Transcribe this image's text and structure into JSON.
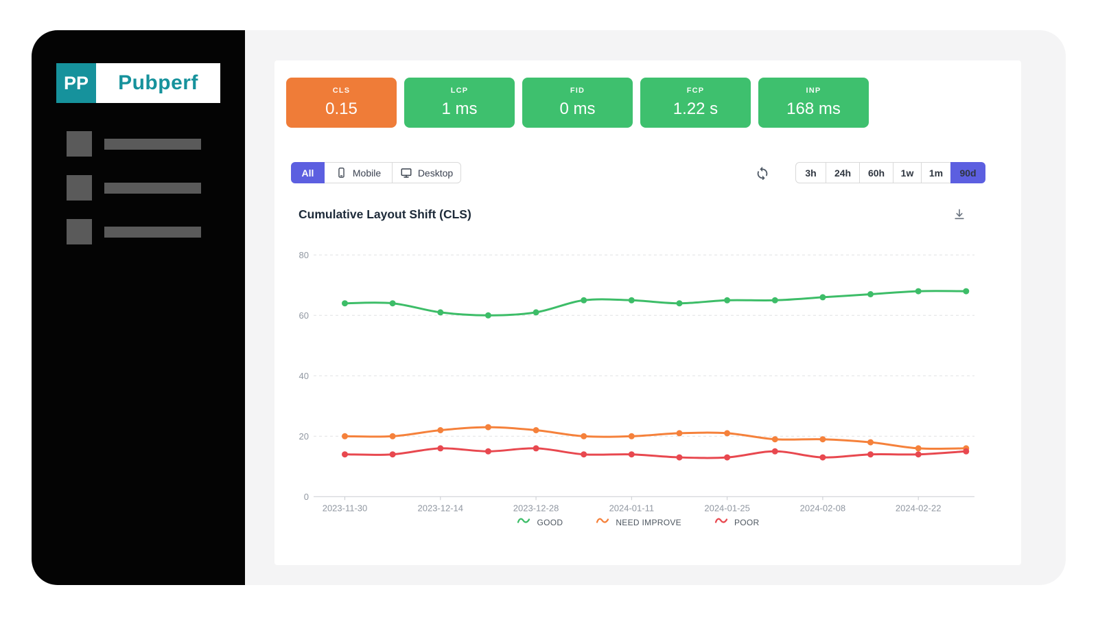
{
  "app": {
    "name": "Pubperf",
    "colors": {
      "sidebar_bg": "#040404",
      "panel_bg": "#f4f4f5",
      "accent_purple": "#5c5fe0",
      "teal": "#16929c",
      "good_green": "#3ec06e",
      "warn_orange": "#ef7c38"
    }
  },
  "sidebar": {
    "logo": {
      "abbr": "PP",
      "name": "Pubperf",
      "teal": "#16929c"
    },
    "skeleton_item_count": 3
  },
  "metrics": {
    "colors": {
      "good": "#3ec06e",
      "warn": "#ef7c38"
    },
    "cards": [
      {
        "label": "CLS",
        "value": "0.15",
        "status": "warn"
      },
      {
        "label": "LCP",
        "value": "1 ms",
        "status": "good"
      },
      {
        "label": "FID",
        "value": "0 ms",
        "status": "good"
      },
      {
        "label": "FCP",
        "value": "1.22 s",
        "status": "good"
      },
      {
        "label": "INP",
        "value": "168 ms",
        "status": "good"
      }
    ]
  },
  "filters": {
    "active_color": "#5c5fe0",
    "device": [
      {
        "label": "All",
        "active": true
      },
      {
        "label": "Mobile",
        "icon": "mobile-icon",
        "active": false
      },
      {
        "label": "Desktop",
        "icon": "desktop-icon",
        "active": false
      }
    ],
    "refresh_icon": "refresh-icon",
    "ranges": [
      {
        "label": "3h",
        "active": false
      },
      {
        "label": "24h",
        "active": false
      },
      {
        "label": "60h",
        "active": false
      },
      {
        "label": "1w",
        "active": false
      },
      {
        "label": "1m",
        "active": false
      },
      {
        "label": "90d",
        "active": true
      }
    ]
  },
  "chart": {
    "title": "Cumulative Layout Shift (CLS)",
    "download_icon": "download-icon"
  },
  "chart_data": {
    "type": "line",
    "title": "Cumulative Layout Shift (CLS)",
    "x": [
      "2023-11-30",
      "2023-12-07",
      "2023-12-14",
      "2023-12-21",
      "2023-12-28",
      "2024-01-04",
      "2024-01-11",
      "2024-01-18",
      "2024-01-25",
      "2024-02-01",
      "2024-02-08",
      "2024-02-15",
      "2024-02-22",
      "2024-02-29"
    ],
    "x_tick_labels": [
      "2023-11-30",
      "2023-12-14",
      "2023-12-28",
      "2024-01-11",
      "2024-01-25",
      "2024-02-08",
      "2024-02-22"
    ],
    "yticks": [
      0,
      20,
      40,
      60,
      80
    ],
    "ylim": [
      0,
      87
    ],
    "grid": "horizontal-dashed",
    "legend_position": "bottom",
    "series": [
      {
        "name": "GOOD",
        "color": "#3dbd68",
        "values": [
          64,
          64,
          61,
          60,
          61,
          65,
          65,
          64,
          65,
          65,
          66,
          67,
          68,
          68
        ]
      },
      {
        "name": "NEED IMPROVE",
        "color": "#f5813b",
        "values": [
          20,
          20,
          22,
          23,
          22,
          20,
          20,
          21,
          21,
          19,
          19,
          18,
          16,
          16
        ]
      },
      {
        "name": "POOR",
        "color": "#e8484f",
        "values": [
          14,
          14,
          16,
          15,
          16,
          14,
          14,
          13,
          13,
          15,
          13,
          14,
          14,
          15
        ]
      }
    ]
  }
}
